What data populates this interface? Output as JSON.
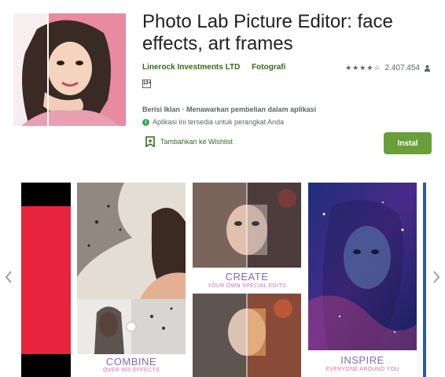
{
  "app": {
    "title": "Photo Lab Picture Editor: face effects, art frames",
    "developer": "Linerock Investments LTD",
    "category": "Fotografi",
    "rating_stars": "★★★★☆",
    "rating_count": "2.407.454",
    "content_rating": "12+"
  },
  "notices": {
    "ads": "Berisi Iklan · Menawarkan pembelian dalam aplikasi",
    "availability": "Aplikasi ini tersedia untuk perangkat Anda"
  },
  "actions": {
    "wishlist": "Tambahkan ke Wishlist",
    "install": "Instal"
  },
  "screenshots": [
    {
      "big": "",
      "small": ""
    },
    {
      "big": "COMBINE",
      "small": "OVER 900 EFFECTS"
    },
    {
      "big": "CREATE",
      "small": "YOUR OWN SPECIAL EDITS"
    },
    {
      "big": "INSPIRE",
      "small": "EVERYONE AROUND YOU"
    }
  ],
  "colors": {
    "brand_green": "#33691e",
    "install_green": "#689f38",
    "caption_purple": "#7e6bb8",
    "caption_pink": "#d66ea7"
  },
  "icons": [
    "person-icon",
    "info-icon",
    "bookmark-icon",
    "chevron-left-icon",
    "chevron-right-icon"
  ]
}
